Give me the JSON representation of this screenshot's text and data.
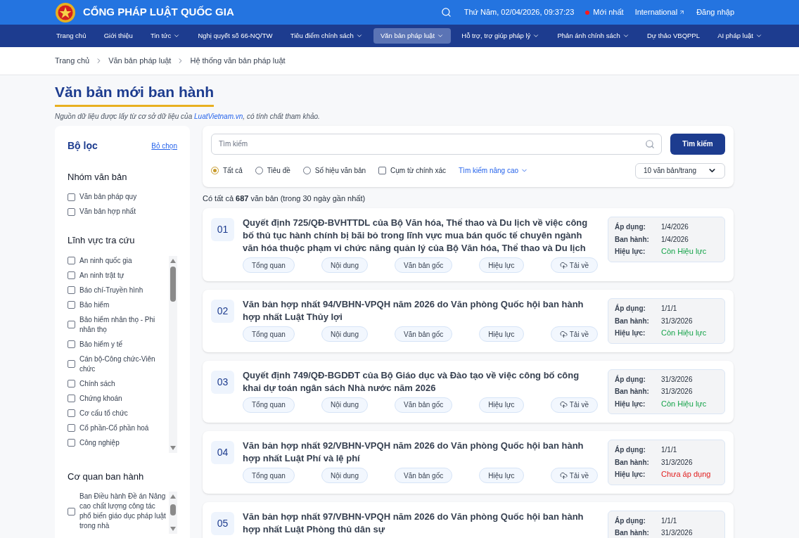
{
  "header": {
    "site_title": "CỔNG PHÁP LUẬT QUỐC GIA",
    "datetime": "Thứ Năm, 02/04/2026, 09:37:23",
    "latest": "Mới nhất",
    "international": "International",
    "login": "Đăng nhập"
  },
  "nav": [
    {
      "label": "Trang chủ",
      "selected": false,
      "dropdown": false
    },
    {
      "label": "Giới thiệu",
      "selected": false,
      "dropdown": false
    },
    {
      "label": "Tin tức",
      "selected": false,
      "dropdown": true
    },
    {
      "label": "Nghị quyết số 66-NQ/TW",
      "selected": false,
      "dropdown": false
    },
    {
      "label": "Tiêu điểm chính sách",
      "selected": false,
      "dropdown": true
    },
    {
      "label": "Văn bản pháp luật",
      "selected": true,
      "dropdown": true
    },
    {
      "label": "Hỗ trợ, trợ giúp pháp lý",
      "selected": false,
      "dropdown": true
    },
    {
      "label": "Phản ánh chính sách",
      "selected": false,
      "dropdown": true
    },
    {
      "label": "Dự thảo VBQPPL",
      "selected": false,
      "dropdown": false
    },
    {
      "label": "AI pháp luật",
      "selected": false,
      "dropdown": true
    }
  ],
  "breadcrumb": [
    "Trang chủ",
    "Văn bản pháp luật",
    "Hệ thống văn bản pháp luật"
  ],
  "page_title": "Văn bản mới ban hành",
  "source_note": {
    "before": "Nguồn dữ liệu được lấy từ cơ sở dữ liệu của ",
    "link": "LuatVietnam.vn",
    "after": ", có tính chất tham khảo."
  },
  "filter": {
    "title": "Bộ lọc",
    "clear": "Bỏ chọn",
    "groups": [
      {
        "title": "Nhóm văn bản",
        "scroll": false,
        "items": [
          {
            "label": "Văn bản pháp quy",
            "checked": false
          },
          {
            "label": "Văn bản hợp nhất",
            "checked": false
          }
        ]
      },
      {
        "title": "Lĩnh vực tra cứu",
        "scroll": true,
        "items": [
          {
            "label": "An ninh quốc gia",
            "checked": false
          },
          {
            "label": "An ninh trật tự",
            "checked": false
          },
          {
            "label": "Báo chí-Truyền hình",
            "checked": false
          },
          {
            "label": "Bảo hiểm",
            "checked": false
          },
          {
            "label": "Bảo hiểm nhân thọ - Phi nhân thọ",
            "checked": false
          },
          {
            "label": "Bảo hiểm y tế",
            "checked": false
          },
          {
            "label": "Cán bộ-Công chức-Viên chức",
            "checked": false
          },
          {
            "label": "Chính sách",
            "checked": false
          },
          {
            "label": "Chứng khoán",
            "checked": false
          },
          {
            "label": "Cơ cấu tổ chức",
            "checked": false
          },
          {
            "label": "Cổ phần-Cổ phần hoá",
            "checked": false
          },
          {
            "label": "Công nghiệp",
            "checked": false
          }
        ]
      },
      {
        "title": "Cơ quan ban hành",
        "scroll": true,
        "items": [
          {
            "label": "Ban Điều hành Đề án Nâng cao chất lượng công tác phổ biến giáo dục pháp luật trong nhà",
            "checked": false
          }
        ]
      }
    ]
  },
  "search": {
    "placeholder": "Tìm kiếm",
    "button": "Tìm kiếm",
    "modes": [
      {
        "label": "Tất cả",
        "kind": "radio",
        "selected": true
      },
      {
        "label": "Tiêu đề",
        "kind": "radio",
        "selected": false
      },
      {
        "label": "Số hiệu văn bản",
        "kind": "radio",
        "selected": false
      },
      {
        "label": "Cụm từ chính xác",
        "kind": "checkbox",
        "selected": false
      }
    ],
    "advanced": "Tìm kiếm nâng cao",
    "page_size": "10 văn bản/trang"
  },
  "summary": {
    "before": "Có tất cả ",
    "count": "687",
    "after": " văn bản (trong 30 ngày gần nhất)"
  },
  "documents": [
    {
      "number": "01",
      "title": "Quyết định 725/QĐ-BVHTTDL của Bộ Văn hóa, Thể thao và Du lịch về việc công bố thủ tục hành chính bị bãi bỏ trong lĩnh vực mua bán quốc tế chuyên ngành văn hóa thuộc phạm vi chức năng quản lý của Bộ Văn hóa, Thể thao và Du lịch",
      "actions": [
        "Tổng quan",
        "Nội dung",
        "Văn bản gốc",
        "Hiệu lực",
        "Tải về"
      ],
      "info": [
        {
          "label": "Áp dụng:",
          "value": "1/4/2026"
        },
        {
          "label": "Ban hành:",
          "value": "1/4/2026"
        },
        {
          "label": "Hiệu lực:",
          "value": "Còn Hiệu lực",
          "color": "#16a34a"
        }
      ]
    },
    {
      "number": "02",
      "title": "Văn bản hợp nhất 94/VBHN-VPQH năm 2026 do Văn phòng Quốc hội ban hành hợp nhất Luật Thủy lợi",
      "actions": [
        "Tổng quan",
        "Nội dung",
        "Văn bản gốc",
        "Hiệu lực",
        "Tải về"
      ],
      "info": [
        {
          "label": "Áp dụng:",
          "value": "1/1/1"
        },
        {
          "label": "Ban hành:",
          "value": "31/3/2026"
        },
        {
          "label": "Hiệu lực:",
          "value": "Còn Hiệu lực",
          "color": "#16a34a"
        }
      ]
    },
    {
      "number": "03",
      "title": "Quyết định 749/QĐ-BGDĐT của Bộ Giáo dục và Đào tạo về việc công bố công khai dự toán ngân sách Nhà nước năm 2026",
      "actions": [
        "Tổng quan",
        "Nội dung",
        "Văn bản gốc",
        "Hiệu lực",
        "Tải về"
      ],
      "info": [
        {
          "label": "Áp dụng:",
          "value": "31/3/2026"
        },
        {
          "label": "Ban hành:",
          "value": "31/3/2026"
        },
        {
          "label": "Hiệu lực:",
          "value": "Còn Hiệu lực",
          "color": "#16a34a"
        }
      ]
    },
    {
      "number": "04",
      "title": "Văn bản hợp nhất 92/VBHN-VPQH năm 2026 do Văn phòng Quốc hội ban hành hợp nhất Luật Phí và lệ phí",
      "actions": [
        "Tổng quan",
        "Nội dung",
        "Văn bản gốc",
        "Hiệu lực",
        "Tải về"
      ],
      "info": [
        {
          "label": "Áp dụng:",
          "value": "1/1/1"
        },
        {
          "label": "Ban hành:",
          "value": "31/3/2026"
        },
        {
          "label": "Hiệu lực:",
          "value": "Chưa áp dụng",
          "color": "#e11d1d"
        }
      ]
    },
    {
      "number": "05",
      "title": "Văn bản hợp nhất 97/VBHN-VPQH năm 2026 do Văn phòng Quốc hội ban hành hợp nhất Luật Phòng thủ dân sự",
      "info": [
        {
          "label": "Áp dụng:",
          "value": "1/1/1"
        },
        {
          "label": "Ban hành:",
          "value": "31/3/2026"
        }
      ]
    }
  ]
}
